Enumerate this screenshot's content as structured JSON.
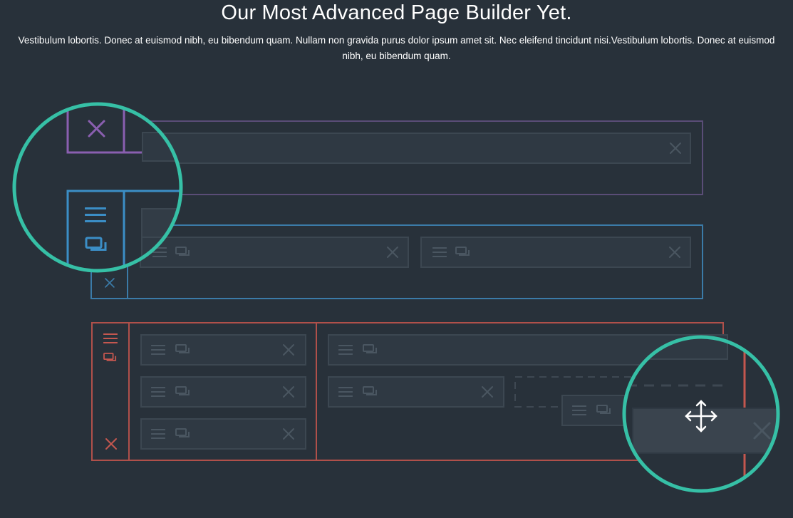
{
  "hero": {
    "title": "Our Most Advanced Page Builder Yet.",
    "description": "Vestibulum lobortis. Donec at euismod nibh, eu bibendum quam. Nullam non gravida purus dolor ipsum amet sit. Nec  eleifend tincidunt nisi.Vestibulum lobortis. Donec at euismod nibh, eu bibendum quam."
  },
  "colors": {
    "background": "#28313a",
    "module_fill": "#2f3943",
    "module_border": "#3c4751",
    "module_icon": "#4a5661",
    "section_purple": "#8a5fb0",
    "section_blue": "#3b8ec6",
    "section_red": "#c4574f",
    "magnifier_ring": "#36c0a6",
    "drag_module_fill": "#3a444e"
  },
  "icons": {
    "menu": "hamburger-icon",
    "duplicate": "duplicate-icon",
    "delete": "close-icon",
    "move": "move-icon"
  }
}
